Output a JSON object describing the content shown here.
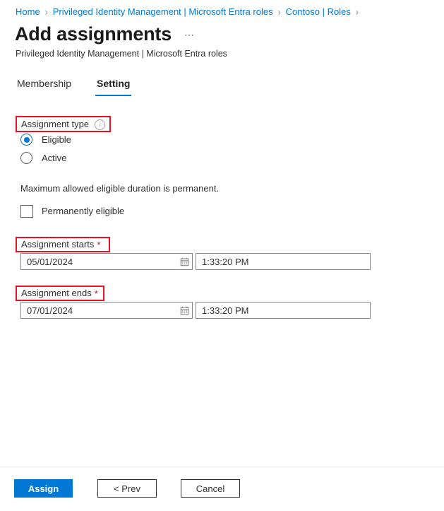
{
  "breadcrumb": {
    "separator": "›",
    "items": [
      {
        "label": "Home"
      },
      {
        "label": "Privileged Identity Management | Microsoft Entra roles"
      },
      {
        "label": "Contoso | Roles"
      }
    ],
    "trailing_separator": "›"
  },
  "header": {
    "title": "Add assignments",
    "ellipsis": "⋯",
    "subtitle": "Privileged Identity Management | Microsoft Entra roles"
  },
  "tabs": [
    {
      "label": "Membership",
      "active": false
    },
    {
      "label": "Setting",
      "active": true
    }
  ],
  "form": {
    "assignment_type": {
      "label": "Assignment type",
      "info_icon": "info-icon",
      "info_glyph": "i",
      "options": [
        {
          "label": "Eligible",
          "selected": true
        },
        {
          "label": "Active",
          "selected": false
        }
      ]
    },
    "helper_text": "Maximum allowed eligible duration is permanent.",
    "permanently_eligible": {
      "label": "Permanently eligible",
      "checked": false
    },
    "assignment_starts": {
      "label": "Assignment starts",
      "required_marker": "*",
      "date_value": "05/01/2024",
      "date_icon": "calendar-icon",
      "time_value": "1:33:20 PM"
    },
    "assignment_ends": {
      "label": "Assignment ends",
      "required_marker": "*",
      "date_value": "07/01/2024",
      "date_icon": "calendar-icon",
      "time_value": "1:33:20 PM"
    }
  },
  "footer": {
    "assign_label": "Assign",
    "prev_label": "< Prev",
    "cancel_label": "Cancel"
  },
  "colors": {
    "accent": "#0078d4",
    "annotation": "#e81123",
    "required": "#a4262c",
    "link": "#0078d4"
  }
}
